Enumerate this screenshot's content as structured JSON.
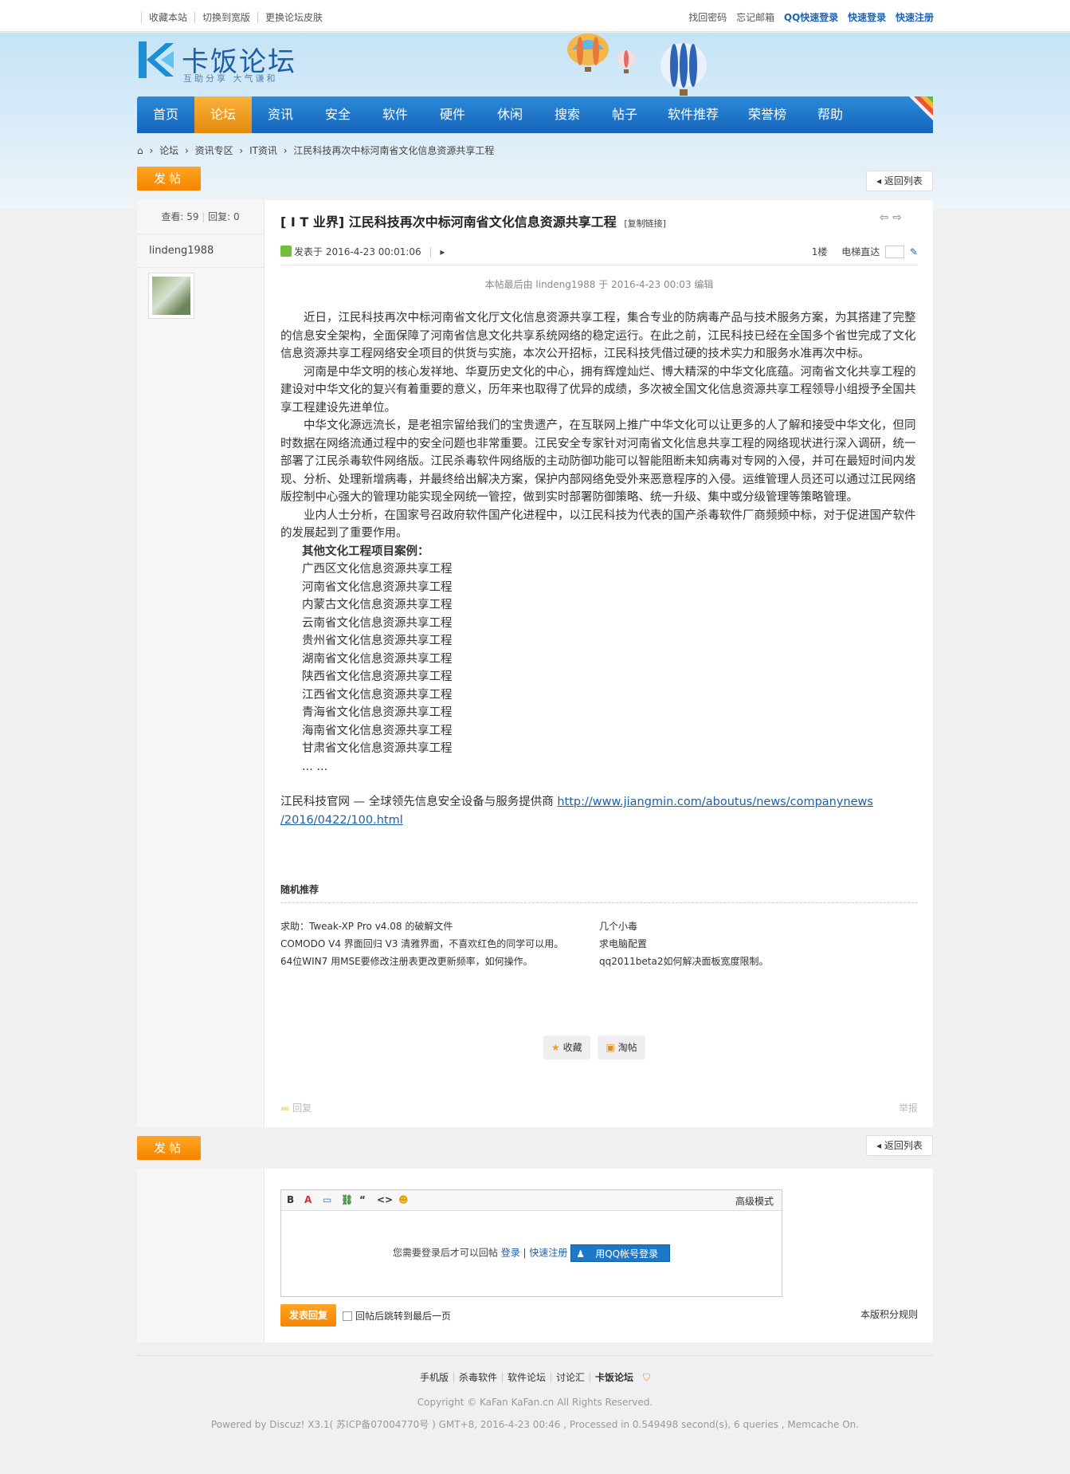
{
  "topbar": {
    "left_items": [
      "收藏本站",
      "切换到宽版",
      "更换论坛皮肤"
    ],
    "right_items": [
      "找回密码",
      "忘记邮箱"
    ],
    "qq_login": "QQ快速登录",
    "quick_login": "快速登录",
    "quick_register": "快速注册"
  },
  "logo": {
    "title": "卡饭论坛",
    "subtitle": "互助分享  大气谦和"
  },
  "nav": [
    "首页",
    "论坛",
    "资讯",
    "安全",
    "软件",
    "硬件",
    "休闲",
    "搜索",
    "帖子",
    "软件推荐",
    "荣誉榜",
    "帮助"
  ],
  "nav_active": "论坛",
  "breadcrumb": [
    "论坛",
    "资讯专区",
    "IT资讯",
    "江民科技再次中标河南省文化信息资源共享工程"
  ],
  "buttons": {
    "post": "发帖",
    "back": "返回列表",
    "favorite": "收藏",
    "taotie": "淘帖",
    "reply": "回复",
    "report": "举报",
    "submit_reply": "发表回复"
  },
  "post": {
    "views_label": "查看:",
    "views": "59",
    "replies_label": "回复:",
    "replies": "0",
    "author": "lindeng1988",
    "category": "[ I T 业界]",
    "title": "江民科技再次中标河南省文化信息资源共享工程",
    "copy_link": "[复制链接]",
    "posted_label": "发表于",
    "posted_time": "2016-4-23 00:01:06",
    "floor": "1楼",
    "elevator": "电梯直达",
    "edited_note": "本帖最后由 lindeng1988 于 2016-4-23 00:03 编辑",
    "paragraphs": [
      "近日，江民科技再次中标河南省文化厅文化信息资源共享工程，集合专业的防病毒产品与技术服务方案，为其搭建了完整的信息安全架构，全面保障了河南省信息文化共享系统网络的稳定运行。在此之前，江民科技已经在全国多个省世完成了文化信息资源共享工程网络安全项目的供货与实施，本次公开招标，江民科技凭借过硬的技术实力和服务水准再次中标。",
      "河南是中华文明的核心发祥地、华夏历史文化的中心，拥有辉煌灿烂、博大精深的中华文化底蕴。河南省文化共享工程的建设对中华文化的复兴有着重要的意义，历年来也取得了优异的成绩，多次被全国文化信息资源共享工程领导小组授予全国共享工程建设先进单位。",
      "中华文化源远流长，是老祖宗留给我们的宝贵遗产，在互联网上推广中华文化可以让更多的人了解和接受中华文化，但同时数据在网络流通过程中的安全问题也非常重要。江民安全专家针对河南省文化信息共享工程的网络现状进行深入调研，统一部署了江民杀毒软件网络版。江民杀毒软件网络版的主动防御功能可以智能阻断未知病毒对专网的入侵，并可在最短时间内发现、分析、处理新增病毒，并最终给出解决方案，保护内部网络免受外来恶意程序的入侵。运维管理人员还可以通过江民网络版控制中心强大的管理功能实现全网统一管控，做到实时部署防御策略、统一升级、集中或分级管理等策略管理。",
      "业内人士分析，在国家号召政府软件国产化进程中，以江民科技为代表的国产杀毒软件厂商频频中标，对于促进国产软件的发展起到了重要作用。"
    ],
    "cases_heading": "其他文化工程项目案例：",
    "cases": [
      "广西区文化信息资源共享工程",
      "河南省文化信息资源共享工程",
      "内蒙古文化信息资源共享工程",
      "云南省文化信息资源共享工程",
      "贵州省文化信息资源共享工程",
      "湖南省文化信息资源共享工程",
      "陕西省文化信息资源共享工程",
      "江西省文化信息资源共享工程",
      "青海省文化信息资源共享工程",
      "海南省文化信息资源共享工程",
      "甘肃省文化信息资源共享工程"
    ],
    "ellipsis": "... ...",
    "official_site": "江民科技官网 — 全球领先信息安全设备与服务提供商",
    "official_url_1": "http://www.jiangmin.com/aboutus/news/companynews",
    "official_url_2": "/2016/0422/100.html"
  },
  "random": {
    "heading": "随机推荐",
    "left": [
      "求助：Tweak-XP Pro v4.08 的破解文件",
      "COMODO V4 界面回归 V3 清雅界面，不喜欢红色的同学可以用。",
      "64位WIN7 用MSE要修改注册表更改更新频率，如何操作。"
    ],
    "right": [
      "几个小毒",
      "求电脑配置",
      "qq2011beta2如何解决面板宽度限制。"
    ]
  },
  "editor": {
    "advanced": "高级模式",
    "login_msg": "您需要登录后才可以回帖",
    "login": "登录",
    "register": "快速注册",
    "qq_btn": "用QQ帐号登录",
    "jump_last": "回帖后跳转到最后一页",
    "rules": "本版积分规则"
  },
  "footer": {
    "links": [
      "手机版",
      "杀毒软件",
      "软件论坛",
      "讨论汇",
      "卡饭论坛"
    ],
    "copyright": "Copyright © KaFan  KaFan.cn All Rights Reserved.",
    "powered": "Powered by Discuz! X3.1( 苏ICP备07004770号 ) GMT+8, 2016-4-23 00:46 , Processed in 0.549498 second(s), 6 queries , Memcache On."
  }
}
